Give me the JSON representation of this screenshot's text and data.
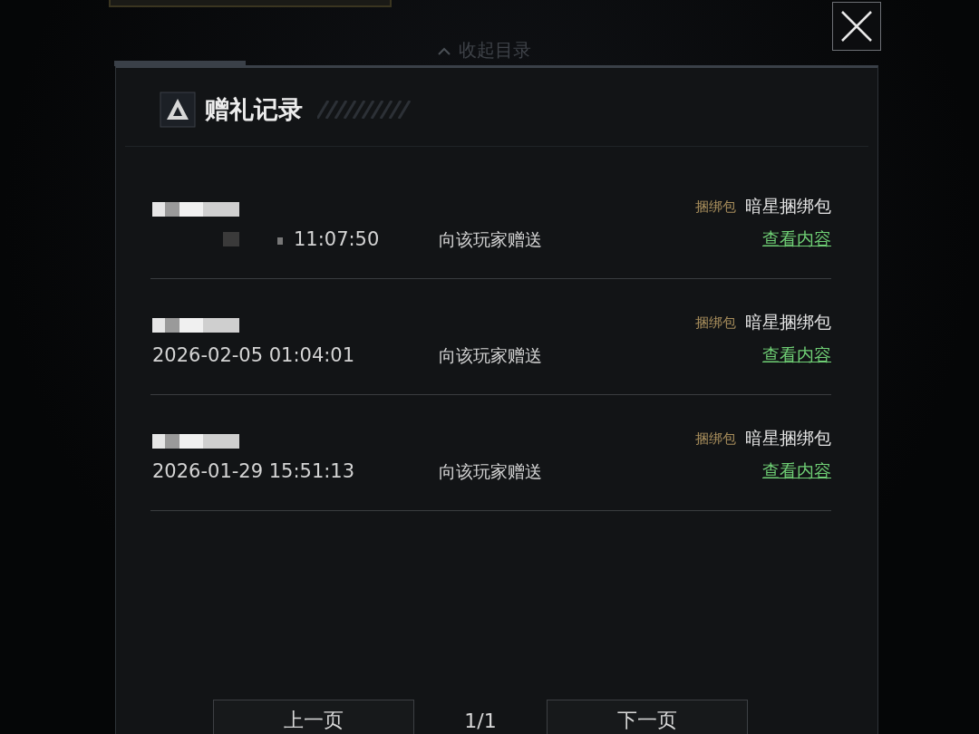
{
  "background": {
    "collapse_label": "收起目录"
  },
  "dialog": {
    "title": "赠礼记录"
  },
  "records": [
    {
      "time": "11:07:50",
      "time_redacted": true,
      "action": "向该玩家赠送",
      "tag": "捆绑包",
      "item": "暗星捆绑包",
      "link": "查看内容"
    },
    {
      "time": "2026-02-05 01:04:01",
      "time_redacted": false,
      "action": "向该玩家赠送",
      "tag": "捆绑包",
      "item": "暗星捆绑包",
      "link": "查看内容"
    },
    {
      "time": "2026-01-29 15:51:13",
      "time_redacted": false,
      "action": "向该玩家赠送",
      "tag": "捆绑包",
      "item": "暗星捆绑包",
      "link": "查看内容"
    }
  ],
  "pager": {
    "prev": "上一页",
    "page": "1/1",
    "next": "下一页"
  }
}
